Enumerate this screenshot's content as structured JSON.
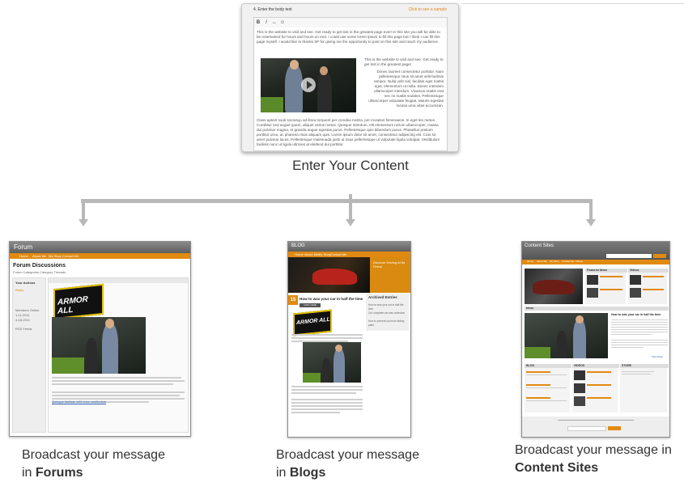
{
  "editor": {
    "step_label": "4. Enter the body text",
    "sample_link": "Click to see a sample",
    "toolbar": [
      "B",
      "I",
      "↔",
      "☺"
    ],
    "para1": "This is the website to visit and see. Get ready to get lost in the greatest page ever! In this site you will be able to be entertained for hours and hours on end. I could use some lorem ipsum to fill this page but I think I can fill this page myself. I would like to thanks SP for giving me the opportunity to post on this site and reach my audience.",
    "side_head": "This is the website to visit and see. Get ready to get lost in the greatest page!",
    "side_text": "Donec laoreet consectetur porttitor. Nam pellentesque risus sit amet velit facilisis tempor. Nulla velit nisl, facilisis eget mattis eget, elementum ut nulla. Donec interdum ullamcorper interdum. Vivamus mattis erat nec mi mattis sodales. Pellentesque ullamcorper vulputate feugiat. Mauris egestas lacinia urna vitae accumsan.",
    "para2": "Class aptent taciti sociosqu ad litora torquent per conubia nostra, per inceptos himenaeos. In eget leo metus. Curabitur sed augue quam, aliquet varius metus. Quisque interdum, elit elementum rutrum ullamcorper, massa dui pulvinar magna, et gravida augue egestas purus. Pellentesque quis bibendum purus. Phasellus pretium porttitor urna, ac pharetra risus aliquam quis. Lorem ipsum dolor sit amet, consectetur adipiscing elit. Cras sit amet pulvinar lacus. Pellentesque malesuada justo ut risus pellentesque ut vulputate ligula volutpat. Vestibulum facilisis nunc ut ligula ultricies at eleifend dui porttitor."
  },
  "enter_label": "Enter Your Content",
  "forum": {
    "title": "Forum",
    "nav": [
      "Home",
      "About Me",
      "My Story",
      "Contact Me"
    ],
    "heading": "Forum Discussions",
    "crumb": "Forum Categories Category Threads",
    "sidebar_title": "Your Actions",
    "sidebar_items": [
      "Reply",
      "Members Online",
      "1-11-2011",
      "4-18-2011",
      "RSS Feeds"
    ],
    "logo": "ARMOR ALL",
    "link": "Quisque facilisis velit enim vestibulum"
  },
  "blog": {
    "title": "BLOG",
    "nav": [
      "Home",
      "About Me",
      "My Story",
      "Contact Me"
    ],
    "hero_text": "Discover Driving At Its Finest",
    "date_num": "15",
    "post_title": "How to wax your car in half the time",
    "tag": "CAR CARE",
    "logo": "ARMOR ALL",
    "archive_title": "Archived Entries",
    "archive_items": [
      "How to wax your car in half the time",
      "Our complete car wax collection",
      "How to prevent sun from fading paint"
    ]
  },
  "site": {
    "title": "Content Sites",
    "nav": [
      "Home",
      "About Me",
      "My Story",
      "Contact Me",
      "Videos"
    ],
    "featured_title": "Featured Items",
    "videos_title": "Videos",
    "news_title": "News",
    "news_headline": "How to wax your car in half the time",
    "col_titles": [
      "BLOG",
      "VIDEOS",
      "STORE"
    ],
    "more_link": "View More"
  },
  "captions": {
    "forums_line1": "Broadcast your message",
    "forums_pre": "in ",
    "forums_bold": "Forums",
    "blogs_line1": "Broadcast your message",
    "blogs_pre": "in ",
    "blogs_bold": "Blogs",
    "sites_line1": "Broadcast your message in",
    "sites_bold": "Content Sites"
  },
  "colors": {
    "accent_orange": "#e18a12",
    "connector_gray": "#b8b8b8",
    "header_gray": "#6e6e6e"
  }
}
